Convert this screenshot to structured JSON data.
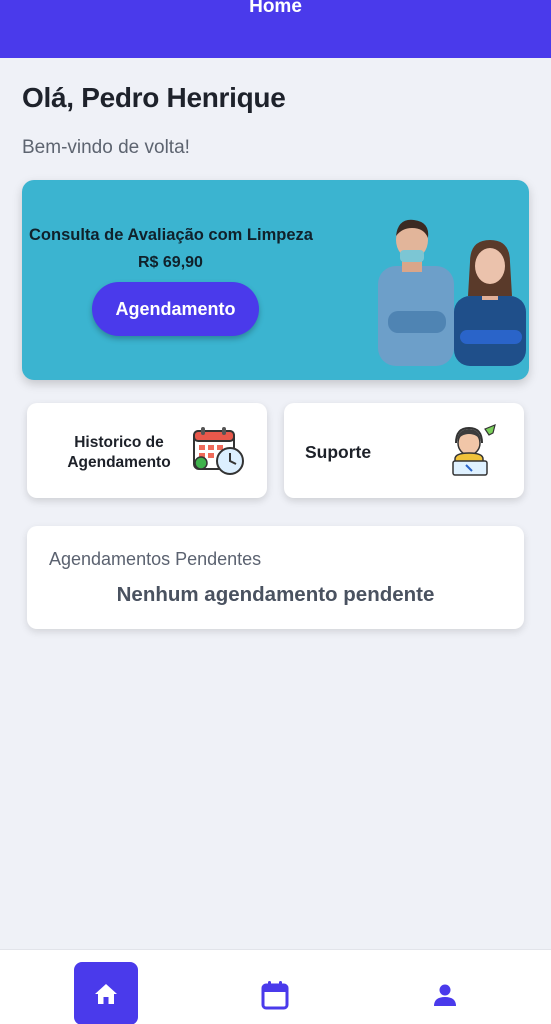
{
  "header": {
    "title": "Home"
  },
  "greeting": "Olá, Pedro Henrique",
  "welcome": "Bem-vindo de volta!",
  "promo": {
    "title": "Consulta de Avaliação com Limpeza",
    "price": "R$ 69,90",
    "button_label": "Agendamento"
  },
  "cards": {
    "historico_label_line1": "Historico de",
    "historico_label_line2": "Agendamento",
    "suporte_label": "Suporte"
  },
  "pending": {
    "title": "Agendamentos Pendentes",
    "empty_message": "Nenhum agendamento pendente"
  },
  "nav": {
    "items": [
      {
        "icon": "home-icon",
        "active": true
      },
      {
        "icon": "calendar-icon",
        "active": false
      },
      {
        "icon": "user-icon",
        "active": false
      }
    ]
  },
  "colors": {
    "primary": "#4a3aeb",
    "promo_bg": "#3bb4d0",
    "page_bg": "#eff1f7"
  }
}
